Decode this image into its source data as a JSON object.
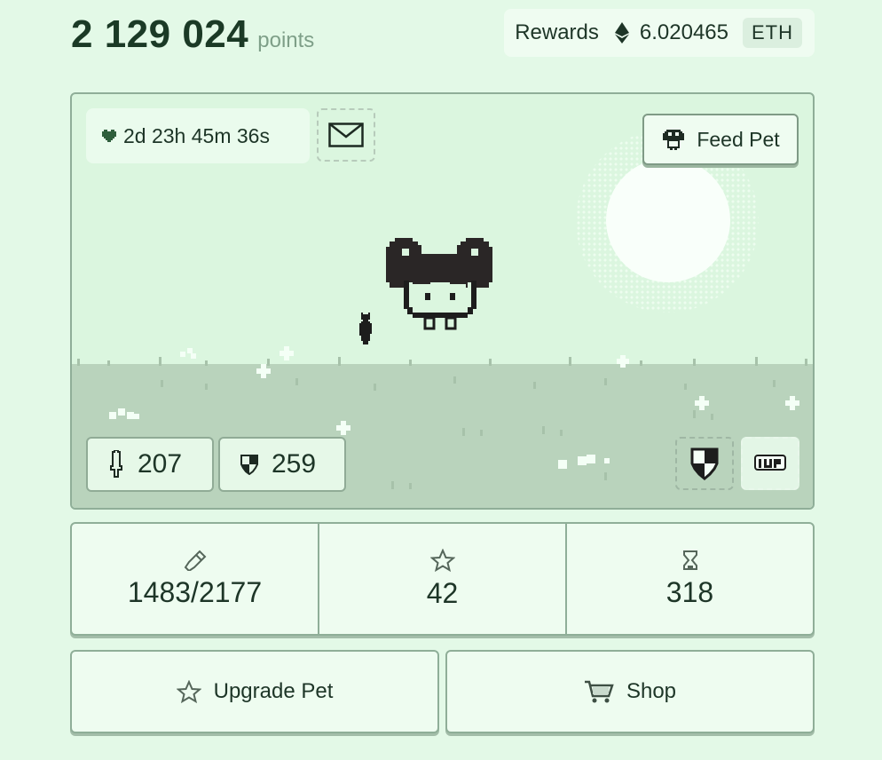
{
  "header": {
    "points_value": "2 129 024",
    "points_label": "points",
    "rewards_label": "Rewards",
    "rewards_value": "6.020465",
    "rewards_currency": "ETH"
  },
  "pet": {
    "timer": "2d 23h 45m 36s",
    "feed_label": "Feed Pet",
    "attack": "207",
    "defense": "259"
  },
  "stats": {
    "experience": "1483/2177",
    "stars": "42",
    "age": "318"
  },
  "actions": {
    "upgrade_label": "Upgrade Pet",
    "shop_label": "Shop"
  },
  "icons": {
    "heart": "heart-icon",
    "mail": "mail-icon",
    "feed": "mushroom-icon",
    "attack": "sword-icon",
    "defense": "shield-icon",
    "experience": "pencil-icon",
    "stars": "star-icon",
    "age": "hourglass-icon",
    "shop": "cart-icon",
    "extra_life": "1up-icon"
  },
  "colors": {
    "background": "#e3f9e7",
    "sky": "#dbf6df",
    "ground": "#b9d3bc",
    "border": "#8fae98",
    "text": "#1d3527"
  }
}
